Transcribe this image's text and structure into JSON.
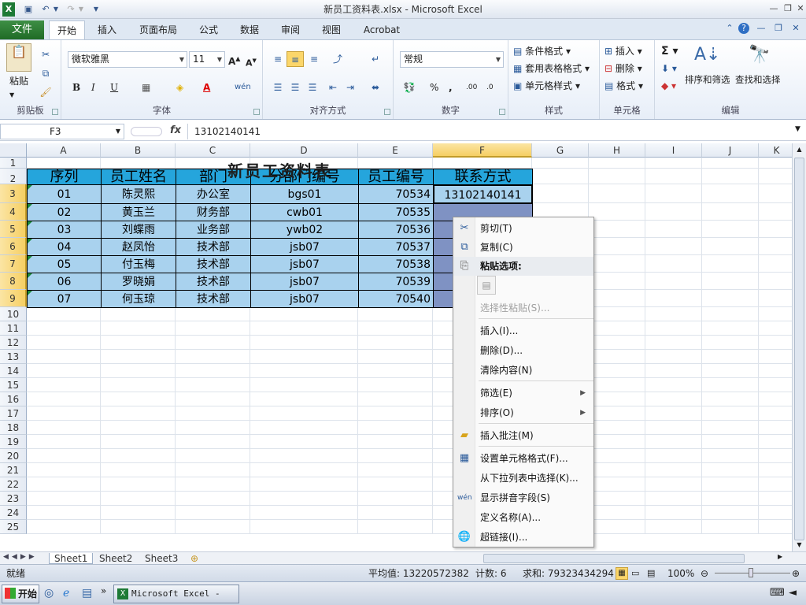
{
  "window": {
    "title": "新员工资料表.xlsx - Microsoft Excel"
  },
  "tabs": {
    "file": "文件",
    "items": [
      "开始",
      "插入",
      "页面布局",
      "公式",
      "数据",
      "审阅",
      "视图",
      "Acrobat"
    ]
  },
  "ribbon": {
    "clipboard": {
      "label": "剪贴板",
      "paste": "粘贴"
    },
    "font": {
      "label": "字体",
      "name": "微软雅黑",
      "size": "11"
    },
    "alignment": {
      "label": "对齐方式"
    },
    "number": {
      "label": "数字",
      "format": "常规"
    },
    "styles": {
      "label": "样式",
      "cond": "条件格式",
      "table": "套用表格格式",
      "cell": "单元格样式"
    },
    "cells": {
      "label": "单元格",
      "insert": "插入",
      "delete": "删除",
      "format": "格式"
    },
    "editing": {
      "label": "编辑",
      "sort": "排序和筛选",
      "find": "查找和选择"
    }
  },
  "formula_bar": {
    "name_box": "F3",
    "fx": "fx",
    "value": "13102140141"
  },
  "sheet": {
    "columns": [
      "A",
      "B",
      "C",
      "D",
      "E",
      "F",
      "G",
      "H",
      "I",
      "J",
      "K"
    ],
    "rows": [
      "1",
      "2",
      "3",
      "4",
      "5",
      "6",
      "7",
      "8",
      "9",
      "10",
      "11",
      "12",
      "13",
      "14",
      "15",
      "16",
      "17",
      "18",
      "19",
      "20",
      "21",
      "22",
      "23",
      "24",
      "25"
    ],
    "title": "新员工资料表",
    "headers": [
      "序列",
      "员工姓名",
      "部门",
      "分部门编号",
      "员工编号",
      "联系方式"
    ],
    "data": [
      [
        "01",
        "陈灵熙",
        "办公室",
        "bgs01",
        "70534",
        "13102140141"
      ],
      [
        "02",
        "黄玉兰",
        "财务部",
        "cwb01",
        "70535",
        ""
      ],
      [
        "03",
        "刘蝶雨",
        "业务部",
        "ywb02",
        "70536",
        ""
      ],
      [
        "04",
        "赵凤怡",
        "技术部",
        "jsb07",
        "70537",
        ""
      ],
      [
        "05",
        "付玉梅",
        "技术部",
        "jsb07",
        "70538",
        ""
      ],
      [
        "06",
        "罗晓娟",
        "技术部",
        "jsb07",
        "70539",
        ""
      ],
      [
        "07",
        "何玉琼",
        "技术部",
        "jsb07",
        "70540",
        ""
      ]
    ]
  },
  "sheet_tabs": [
    "Sheet1",
    "Sheet2",
    "Sheet3"
  ],
  "context_menu": {
    "cut": "剪切(T)",
    "copy": "复制(C)",
    "paste_options": "粘贴选项:",
    "paste_special": "选择性粘贴(S)...",
    "insert": "插入(I)...",
    "delete": "删除(D)...",
    "clear": "清除内容(N)",
    "filter": "筛选(E)",
    "sort": "排序(O)",
    "comment": "插入批注(M)",
    "format_cells": "设置单元格格式(F)...",
    "pick_list": "从下拉列表中选择(K)...",
    "phonetic": "显示拼音字段(S)",
    "define_name": "定义名称(A)...",
    "hyperlink": "超链接(I)..."
  },
  "status_bar": {
    "ready": "就绪",
    "average": "平均值: 13220572382",
    "count": "计数: 6",
    "sum": "求和: 79323434294",
    "zoom": "100%"
  },
  "taskbar": {
    "start": "开始",
    "item": "Microsoft Excel - ..."
  },
  "colors": {
    "header_fill": "#25a5dc",
    "row_fill": "#a9d2ee",
    "selection_fill": "#7f92c3",
    "file_tab": "#2a7d32"
  }
}
